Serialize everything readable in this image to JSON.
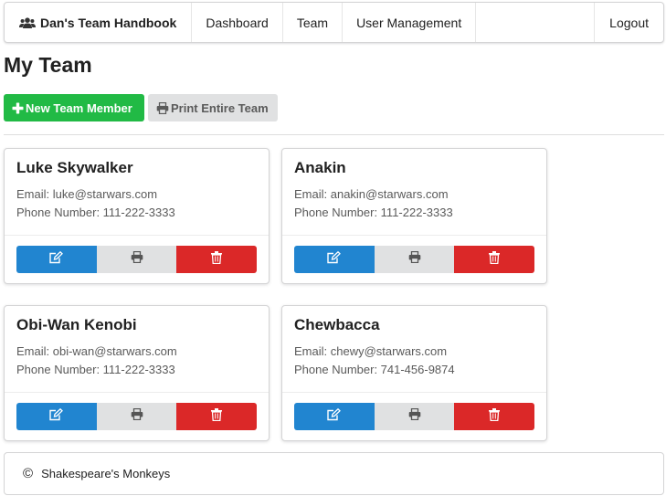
{
  "nav": {
    "brand": "Dan's Team Handbook",
    "brand_icon": "users-icon",
    "items": [
      "Dashboard",
      "Team",
      "User Management"
    ],
    "logout": "Logout"
  },
  "page": {
    "title": "My Team"
  },
  "toolbar": {
    "new_member_label": "New Team Member",
    "new_member_icon": "plus-icon",
    "print_all_label": "Print Entire Team",
    "print_all_icon": "print-icon"
  },
  "members": [
    {
      "name": "Luke Skywalker",
      "email": "Email: luke@starwars.com",
      "phone": "Phone Number: 111-222-3333"
    },
    {
      "name": "Anakin",
      "email": "Email: anakin@starwars.com",
      "phone": "Phone Number: 111-222-3333"
    },
    {
      "name": "Obi-Wan Kenobi",
      "email": "Email: obi-wan@starwars.com",
      "phone": "Phone Number: 111-222-3333"
    },
    {
      "name": "Chewbacca",
      "email": "Email: chewy@starwars.com",
      "phone": "Phone Number: 741-456-9874"
    }
  ],
  "card_actions": {
    "edit_icon": "edit-icon",
    "print_icon": "print-icon",
    "delete_icon": "trash-icon"
  },
  "footer": {
    "copyright_symbol": "©",
    "text": "Shakespeare's Monkeys"
  },
  "colors": {
    "green": "#21ba45",
    "blue": "#2185d0",
    "red": "#db2828",
    "grey": "#e0e1e2"
  }
}
